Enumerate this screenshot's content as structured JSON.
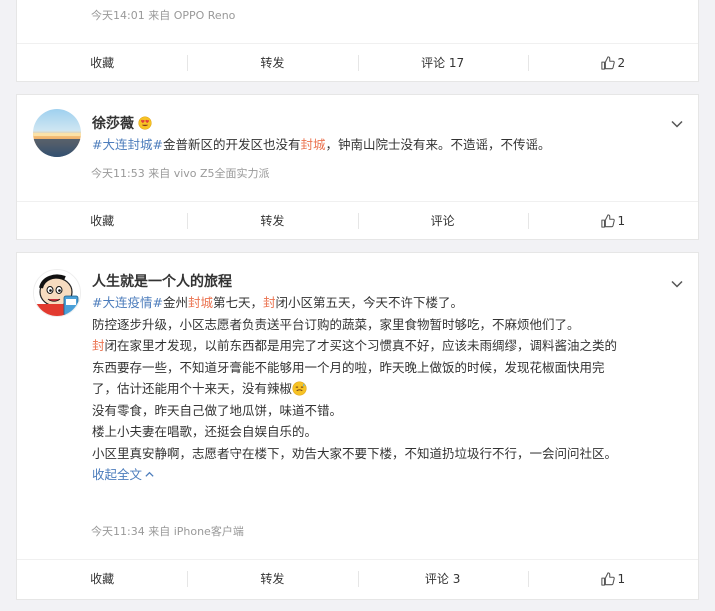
{
  "posts": [
    {
      "meta": "今天14:01  来自 OPPO Reno",
      "actions": {
        "favorite": "收藏",
        "repost": "转发",
        "comment": "评论 17",
        "like": "2"
      }
    },
    {
      "name": "徐莎薇",
      "text": {
        "tag": "#大连封城#",
        "part1": "金普新区的开发区也没有",
        "hl": "封城",
        "part2": "，钟南山院士没有来。不造谣，不传谣。"
      },
      "meta": "今天11:53  来自 vivo Z5全面实力派",
      "actions": {
        "favorite": "收藏",
        "repost": "转发",
        "comment": "评论",
        "like": "1"
      }
    },
    {
      "name": "人生就是一个人的旅程",
      "lines": {
        "l1": {
          "tag": "#大连疫情#",
          "a": "金州",
          "hl1": "封城",
          "b": "第七天，",
          "hl2": "封",
          "c": "闭小区第五天，今天不许下楼了。"
        },
        "l2": "防控逐步升级，小区志愿者负责送平台订购的蔬菜，家里食物暂时够吃，不麻烦他们了。",
        "l3": {
          "hl": "封",
          "rest": "闭在家里才发现，以前东西都是用完了才买这个习惯真不好，应该未雨绸缪，调料酱油之类的"
        },
        "l4": "东西要存一些，不知道牙膏能不能够用一个月的啦，昨天晚上做饭的时候，发现花椒面快用完",
        "l5": "了，估计还能用个十来天，没有辣椒",
        "l6": "没有零食，昨天自己做了地瓜饼，味道不错。",
        "l7": "楼上小夫妻在唱歌，还挺会自娱自乐的。",
        "l8": "小区里真安静啊，志愿者守在楼下，劝告大家不要下楼，不知道扔垃圾行不行，一会问问社区。",
        "expand": "收起全文"
      },
      "meta": "今天11:34  来自 iPhone客户端",
      "actions": {
        "favorite": "收藏",
        "repost": "转发",
        "comment": "评论 3",
        "like": "1"
      }
    }
  ],
  "colors": {
    "highlight": "#eb7350",
    "topic": "#4d7dbc"
  }
}
